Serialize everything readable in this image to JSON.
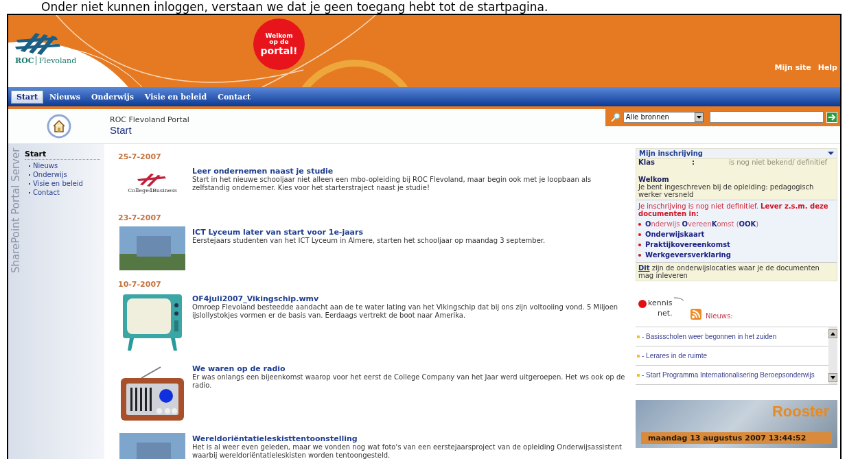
{
  "caption": "Onder niet kunnen inloggen, verstaan we dat je geen toegang hebt tot de startpagina.",
  "header": {
    "logo_text": "ROC",
    "logo_text_2": "Flevoland",
    "badge": [
      "Welkom",
      "op de",
      "portal!"
    ],
    "links": [
      "Mijn site",
      "Help"
    ]
  },
  "nav": [
    {
      "label": "Start",
      "selected": true
    },
    {
      "label": "Nieuws",
      "selected": false
    },
    {
      "label": "Onderwijs",
      "selected": false
    },
    {
      "label": "Visie en beleid",
      "selected": false
    },
    {
      "label": "Contact",
      "selected": false
    }
  ],
  "title_area": {
    "site": "ROC Flevoland Portal",
    "page": "Start"
  },
  "search": {
    "scope": "Alle bronnen"
  },
  "sidebar": {
    "watermark": "SharePoint Portal Server",
    "heading": "Start",
    "items": [
      "Nieuws",
      "Onderwijs",
      "Visie en beleid",
      "Contact"
    ]
  },
  "news": [
    {
      "date": "25-7-2007",
      "items": [
        {
          "kind": "logo",
          "logo_text": "College4Business",
          "title": "Leer ondernemen naast je studie",
          "text": "Start in het nieuwe schooljaar niet alleen een mbo-opleiding bij ROC Flevoland, maar begin ook met je loopbaan als zelfstandig ondernemer. Kies voor het starterstraject naast je studie!"
        }
      ]
    },
    {
      "date": "23-7-2007",
      "items": [
        {
          "kind": "photo",
          "title": "ICT Lyceum later van start voor 1e-jaars",
          "text": "Eerstejaars studenten van het ICT Lyceum in Almere, starten het schooljaar op maandag 3 september."
        }
      ]
    },
    {
      "date": "10-7-2007",
      "items": [
        {
          "kind": "tv",
          "title": "OF4juli2007_Vikingschip.wmv",
          "text": "Omroep Flevoland besteedde aandacht aan de te water lating van het Vikingschip dat bij ons zijn voltooiing vond. 5 Miljoen ijslollystokjes vormen er de basis van. Eerdaags vertrekt de boot naar Amerika."
        },
        {
          "kind": "radio",
          "title": "We waren op de radio",
          "text": "Er was onlangs een bijeenkomst waarop voor het eerst de College Company van het Jaar werd uitgeroepen. Het ws ook op de radio."
        },
        {
          "kind": "photo",
          "title": "Wereldoriëntatieleskisttentoonstelling",
          "text": "Het is al weer even geleden, maar we vonden nog wat foto's van een eerstejaarsproject van de opleiding Onderwijsassistent waarbij wereldoriëntatieleskisten worden tentoongesteld."
        }
      ]
    }
  ],
  "enrollment": {
    "title": "Mijn inschrijving",
    "klas_label": "Klas",
    "klas_sep": ":",
    "klas_value": "is nog niet bekend/ definitief",
    "welcome_title": "Welkom",
    "welcome_text": "Je bent ingeschreven bij de opleiding: pedagogisch werker versneld",
    "notice": "Je inschrijving is nog niet definitief. **Lever z.s.m. deze documenten in:**",
    "documents": [
      {
        "kind": "acronym",
        "text": "**O**nderwijs **O**vereen**K**omst (**OOK**)"
      },
      {
        "kind": "plain",
        "text": "Onderwijskaart"
      },
      {
        "kind": "plain",
        "text": "Praktijkovereenkomst"
      },
      {
        "kind": "plain",
        "text": "Werkgeversverklaring"
      }
    ],
    "footer_link": "Dit",
    "footer_text": " zijn de onderwijslocaties waar je de documenten mag inleveren"
  },
  "kennisnet": {
    "logo": [
      "kennis",
      "net."
    ],
    "label": "Nieuws:",
    "items": [
      "- Basisscholen weer begonnen in het zuiden",
      "- Lerares in de ruimte",
      "- Start Programma Internationalisering Beroepsonderwijs"
    ]
  },
  "rooster": {
    "title": "Rooster",
    "datetime": "maandag 13 augustus 2007 13:44:52"
  }
}
